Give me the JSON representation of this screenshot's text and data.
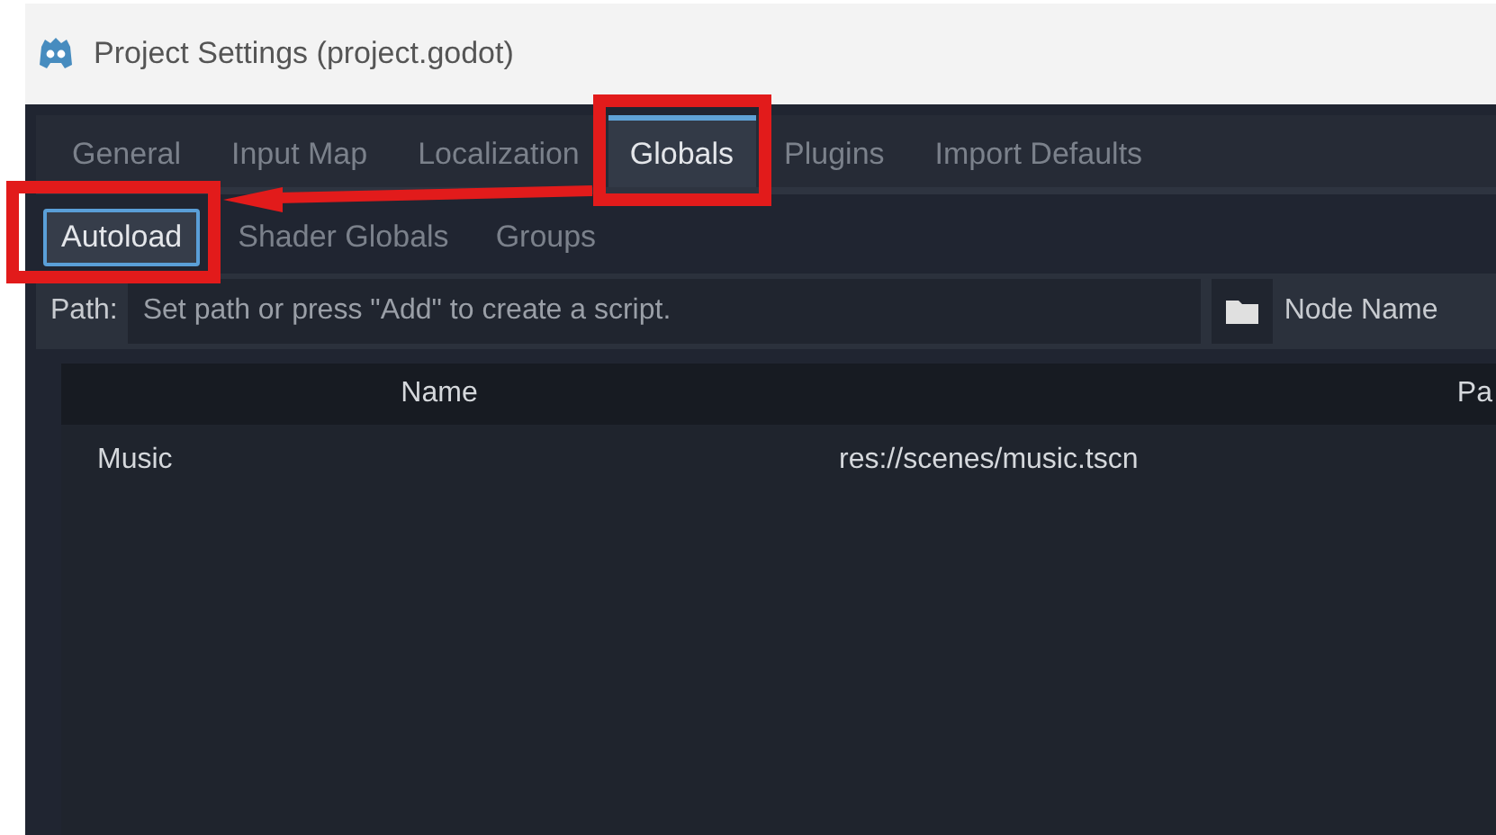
{
  "window": {
    "title": "Project Settings (project.godot)"
  },
  "tabs": [
    {
      "label": "General",
      "selected": false
    },
    {
      "label": "Input Map",
      "selected": false
    },
    {
      "label": "Localization",
      "selected": false
    },
    {
      "label": "Globals",
      "selected": true
    },
    {
      "label": "Plugins",
      "selected": false
    },
    {
      "label": "Import Defaults",
      "selected": false
    }
  ],
  "subtabs": [
    {
      "label": "Autoload",
      "selected": true
    },
    {
      "label": "Shader Globals",
      "selected": false
    },
    {
      "label": "Groups",
      "selected": false
    }
  ],
  "path_field": {
    "label": "Path:",
    "placeholder": "Set path or press \"Add\" to create a script."
  },
  "node_name_label": "Node Name",
  "table": {
    "columns": [
      "Name",
      "Pa"
    ],
    "rows": [
      [
        "Music",
        "res://scenes/music.tscn"
      ]
    ]
  }
}
